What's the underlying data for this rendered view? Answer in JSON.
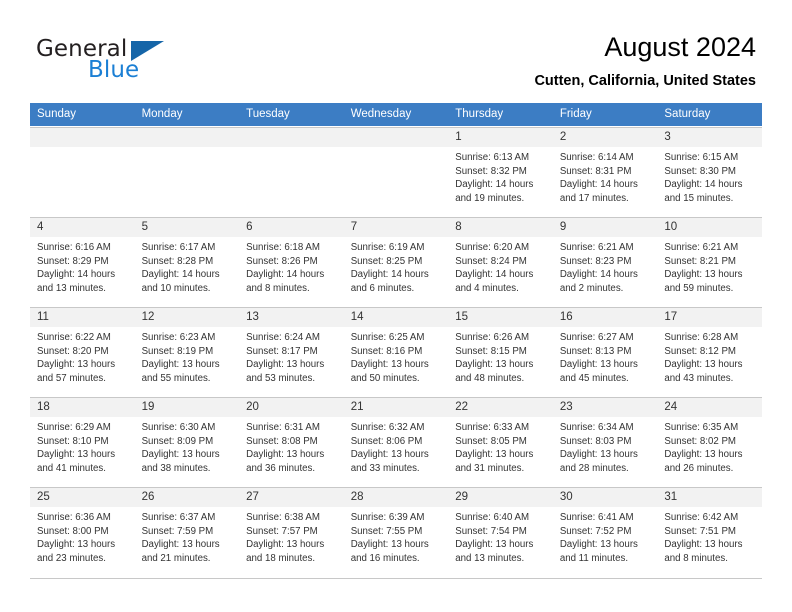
{
  "brand": {
    "word1": "General",
    "word2": "Blue",
    "flag_icon": "triangle-flag-icon",
    "color_primary": "#1565a8",
    "color_accent": "#1b7fd4"
  },
  "header": {
    "title": "August 2024",
    "location": "Cutten, California, United States"
  },
  "calendar": {
    "header_bg": "#3c7dc4",
    "daynum_bg": "#f2f2f2",
    "weekdays": [
      "Sunday",
      "Monday",
      "Tuesday",
      "Wednesday",
      "Thursday",
      "Friday",
      "Saturday"
    ],
    "weeks": [
      [
        {
          "day": "",
          "empty": true,
          "sunrise": "",
          "sunset": "",
          "daylight1": "",
          "daylight2": ""
        },
        {
          "day": "",
          "empty": true,
          "sunrise": "",
          "sunset": "",
          "daylight1": "",
          "daylight2": ""
        },
        {
          "day": "",
          "empty": true,
          "sunrise": "",
          "sunset": "",
          "daylight1": "",
          "daylight2": ""
        },
        {
          "day": "",
          "empty": true,
          "sunrise": "",
          "sunset": "",
          "daylight1": "",
          "daylight2": ""
        },
        {
          "day": "1",
          "empty": false,
          "sunrise": "Sunrise: 6:13 AM",
          "sunset": "Sunset: 8:32 PM",
          "daylight1": "Daylight: 14 hours",
          "daylight2": "and 19 minutes."
        },
        {
          "day": "2",
          "empty": false,
          "sunrise": "Sunrise: 6:14 AM",
          "sunset": "Sunset: 8:31 PM",
          "daylight1": "Daylight: 14 hours",
          "daylight2": "and 17 minutes."
        },
        {
          "day": "3",
          "empty": false,
          "sunrise": "Sunrise: 6:15 AM",
          "sunset": "Sunset: 8:30 PM",
          "daylight1": "Daylight: 14 hours",
          "daylight2": "and 15 minutes."
        }
      ],
      [
        {
          "day": "4",
          "empty": false,
          "sunrise": "Sunrise: 6:16 AM",
          "sunset": "Sunset: 8:29 PM",
          "daylight1": "Daylight: 14 hours",
          "daylight2": "and 13 minutes."
        },
        {
          "day": "5",
          "empty": false,
          "sunrise": "Sunrise: 6:17 AM",
          "sunset": "Sunset: 8:28 PM",
          "daylight1": "Daylight: 14 hours",
          "daylight2": "and 10 minutes."
        },
        {
          "day": "6",
          "empty": false,
          "sunrise": "Sunrise: 6:18 AM",
          "sunset": "Sunset: 8:26 PM",
          "daylight1": "Daylight: 14 hours",
          "daylight2": "and 8 minutes."
        },
        {
          "day": "7",
          "empty": false,
          "sunrise": "Sunrise: 6:19 AM",
          "sunset": "Sunset: 8:25 PM",
          "daylight1": "Daylight: 14 hours",
          "daylight2": "and 6 minutes."
        },
        {
          "day": "8",
          "empty": false,
          "sunrise": "Sunrise: 6:20 AM",
          "sunset": "Sunset: 8:24 PM",
          "daylight1": "Daylight: 14 hours",
          "daylight2": "and 4 minutes."
        },
        {
          "day": "9",
          "empty": false,
          "sunrise": "Sunrise: 6:21 AM",
          "sunset": "Sunset: 8:23 PM",
          "daylight1": "Daylight: 14 hours",
          "daylight2": "and 2 minutes."
        },
        {
          "day": "10",
          "empty": false,
          "sunrise": "Sunrise: 6:21 AM",
          "sunset": "Sunset: 8:21 PM",
          "daylight1": "Daylight: 13 hours",
          "daylight2": "and 59 minutes."
        }
      ],
      [
        {
          "day": "11",
          "empty": false,
          "sunrise": "Sunrise: 6:22 AM",
          "sunset": "Sunset: 8:20 PM",
          "daylight1": "Daylight: 13 hours",
          "daylight2": "and 57 minutes."
        },
        {
          "day": "12",
          "empty": false,
          "sunrise": "Sunrise: 6:23 AM",
          "sunset": "Sunset: 8:19 PM",
          "daylight1": "Daylight: 13 hours",
          "daylight2": "and 55 minutes."
        },
        {
          "day": "13",
          "empty": false,
          "sunrise": "Sunrise: 6:24 AM",
          "sunset": "Sunset: 8:17 PM",
          "daylight1": "Daylight: 13 hours",
          "daylight2": "and 53 minutes."
        },
        {
          "day": "14",
          "empty": false,
          "sunrise": "Sunrise: 6:25 AM",
          "sunset": "Sunset: 8:16 PM",
          "daylight1": "Daylight: 13 hours",
          "daylight2": "and 50 minutes."
        },
        {
          "day": "15",
          "empty": false,
          "sunrise": "Sunrise: 6:26 AM",
          "sunset": "Sunset: 8:15 PM",
          "daylight1": "Daylight: 13 hours",
          "daylight2": "and 48 minutes."
        },
        {
          "day": "16",
          "empty": false,
          "sunrise": "Sunrise: 6:27 AM",
          "sunset": "Sunset: 8:13 PM",
          "daylight1": "Daylight: 13 hours",
          "daylight2": "and 45 minutes."
        },
        {
          "day": "17",
          "empty": false,
          "sunrise": "Sunrise: 6:28 AM",
          "sunset": "Sunset: 8:12 PM",
          "daylight1": "Daylight: 13 hours",
          "daylight2": "and 43 minutes."
        }
      ],
      [
        {
          "day": "18",
          "empty": false,
          "sunrise": "Sunrise: 6:29 AM",
          "sunset": "Sunset: 8:10 PM",
          "daylight1": "Daylight: 13 hours",
          "daylight2": "and 41 minutes."
        },
        {
          "day": "19",
          "empty": false,
          "sunrise": "Sunrise: 6:30 AM",
          "sunset": "Sunset: 8:09 PM",
          "daylight1": "Daylight: 13 hours",
          "daylight2": "and 38 minutes."
        },
        {
          "day": "20",
          "empty": false,
          "sunrise": "Sunrise: 6:31 AM",
          "sunset": "Sunset: 8:08 PM",
          "daylight1": "Daylight: 13 hours",
          "daylight2": "and 36 minutes."
        },
        {
          "day": "21",
          "empty": false,
          "sunrise": "Sunrise: 6:32 AM",
          "sunset": "Sunset: 8:06 PM",
          "daylight1": "Daylight: 13 hours",
          "daylight2": "and 33 minutes."
        },
        {
          "day": "22",
          "empty": false,
          "sunrise": "Sunrise: 6:33 AM",
          "sunset": "Sunset: 8:05 PM",
          "daylight1": "Daylight: 13 hours",
          "daylight2": "and 31 minutes."
        },
        {
          "day": "23",
          "empty": false,
          "sunrise": "Sunrise: 6:34 AM",
          "sunset": "Sunset: 8:03 PM",
          "daylight1": "Daylight: 13 hours",
          "daylight2": "and 28 minutes."
        },
        {
          "day": "24",
          "empty": false,
          "sunrise": "Sunrise: 6:35 AM",
          "sunset": "Sunset: 8:02 PM",
          "daylight1": "Daylight: 13 hours",
          "daylight2": "and 26 minutes."
        }
      ],
      [
        {
          "day": "25",
          "empty": false,
          "sunrise": "Sunrise: 6:36 AM",
          "sunset": "Sunset: 8:00 PM",
          "daylight1": "Daylight: 13 hours",
          "daylight2": "and 23 minutes."
        },
        {
          "day": "26",
          "empty": false,
          "sunrise": "Sunrise: 6:37 AM",
          "sunset": "Sunset: 7:59 PM",
          "daylight1": "Daylight: 13 hours",
          "daylight2": "and 21 minutes."
        },
        {
          "day": "27",
          "empty": false,
          "sunrise": "Sunrise: 6:38 AM",
          "sunset": "Sunset: 7:57 PM",
          "daylight1": "Daylight: 13 hours",
          "daylight2": "and 18 minutes."
        },
        {
          "day": "28",
          "empty": false,
          "sunrise": "Sunrise: 6:39 AM",
          "sunset": "Sunset: 7:55 PM",
          "daylight1": "Daylight: 13 hours",
          "daylight2": "and 16 minutes."
        },
        {
          "day": "29",
          "empty": false,
          "sunrise": "Sunrise: 6:40 AM",
          "sunset": "Sunset: 7:54 PM",
          "daylight1": "Daylight: 13 hours",
          "daylight2": "and 13 minutes."
        },
        {
          "day": "30",
          "empty": false,
          "sunrise": "Sunrise: 6:41 AM",
          "sunset": "Sunset: 7:52 PM",
          "daylight1": "Daylight: 13 hours",
          "daylight2": "and 11 minutes."
        },
        {
          "day": "31",
          "empty": false,
          "sunrise": "Sunrise: 6:42 AM",
          "sunset": "Sunset: 7:51 PM",
          "daylight1": "Daylight: 13 hours",
          "daylight2": "and 8 minutes."
        }
      ]
    ]
  }
}
